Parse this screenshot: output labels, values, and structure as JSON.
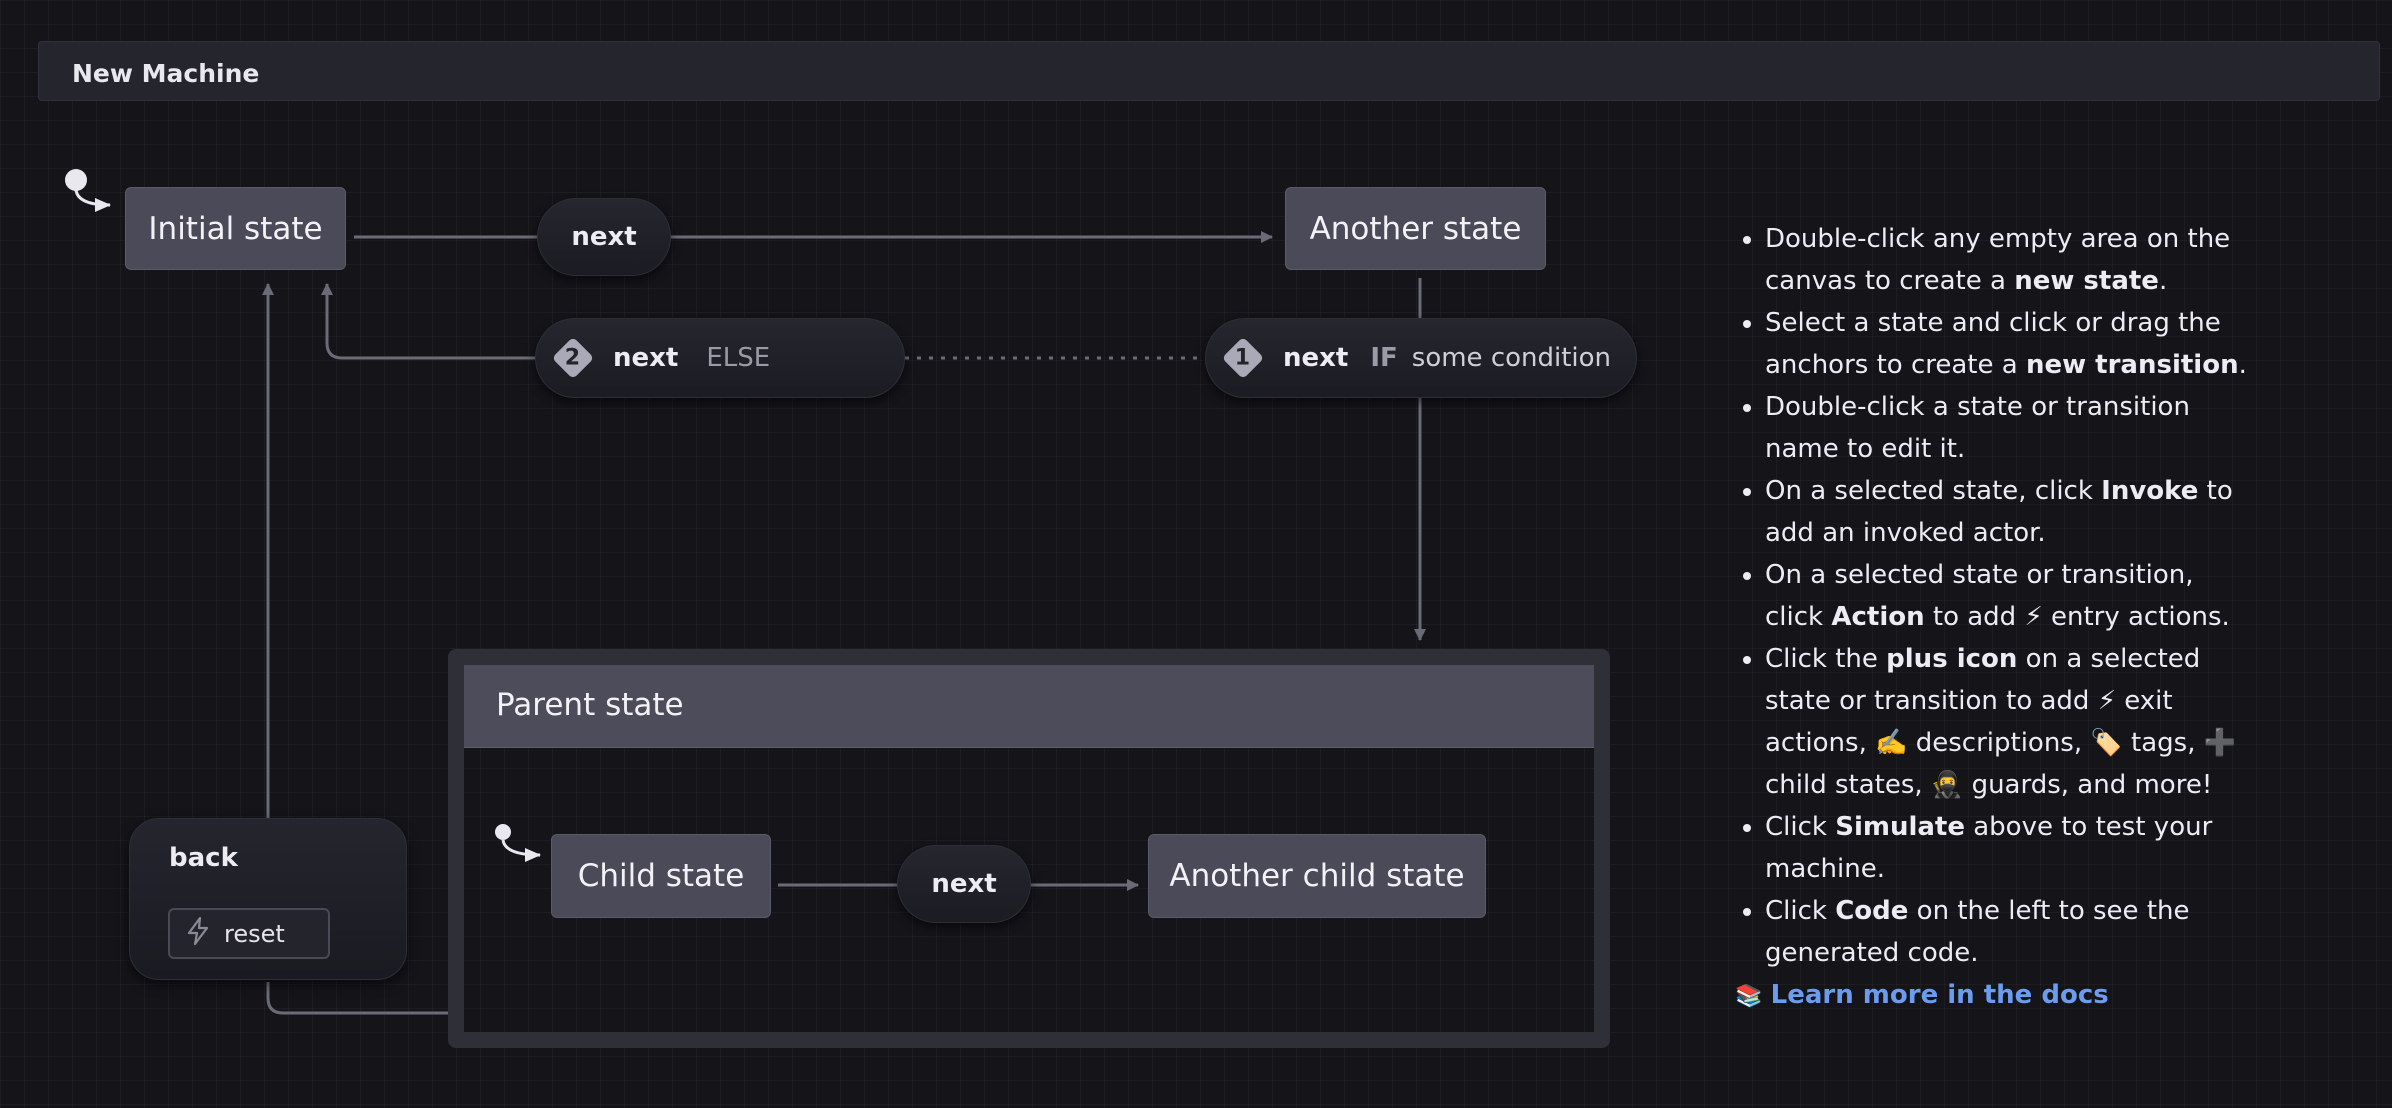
{
  "machine": {
    "title": "New Machine"
  },
  "states": {
    "initial": "Initial state",
    "another": "Another state",
    "parent": "Parent state",
    "child": "Child state",
    "another_child": "Another child state"
  },
  "transitions": {
    "initial_to_another": "next",
    "child_to_another_child": "next",
    "guarded_if": {
      "index": "1",
      "event": "next",
      "keyword": "IF",
      "condition": "some condition"
    },
    "guarded_else": {
      "index": "2",
      "event": "next",
      "keyword": "ELSE"
    },
    "back": {
      "event": "back",
      "action": "reset"
    }
  },
  "instructions": {
    "items": [
      [
        {
          "t": "Double-click any empty area on the canvas to create a "
        },
        {
          "t": "new state",
          "b": true
        },
        {
          "t": "."
        }
      ],
      [
        {
          "t": "Select a state and click or drag the anchors to create a "
        },
        {
          "t": "new transition",
          "b": true
        },
        {
          "t": "."
        }
      ],
      [
        {
          "t": "Double-click a state or transition name to edit it."
        }
      ],
      [
        {
          "t": "On a selected state, click "
        },
        {
          "t": "Invoke",
          "b": true
        },
        {
          "t": " to add an invoked actor."
        }
      ],
      [
        {
          "t": "On a selected state or transition, click "
        },
        {
          "t": "Action",
          "b": true
        },
        {
          "t": " to add ⚡ entry actions."
        }
      ],
      [
        {
          "t": "Click the "
        },
        {
          "t": "plus icon",
          "b": true
        },
        {
          "t": " on a selected state or transition to add ⚡ exit actions, ✍️ descriptions, 🏷️ tags, ➕ child states, 🥷 guards, and more!"
        }
      ],
      [
        {
          "t": "Click "
        },
        {
          "t": "Simulate",
          "b": true
        },
        {
          "t": " above to test your machine."
        }
      ],
      [
        {
          "t": "Click "
        },
        {
          "t": "Code",
          "b": true
        },
        {
          "t": " on the left to see the generated code."
        }
      ]
    ],
    "docs_icon": "📚",
    "docs_link": "Learn more in the docs"
  },
  "colors": {
    "edge": "#6b6b78",
    "state_fill": "#4a4a58",
    "link": "#6b9cf0"
  },
  "icons": {
    "initial_marker": "initial-state-arrow-icon",
    "action": "lightning-bolt-icon"
  }
}
